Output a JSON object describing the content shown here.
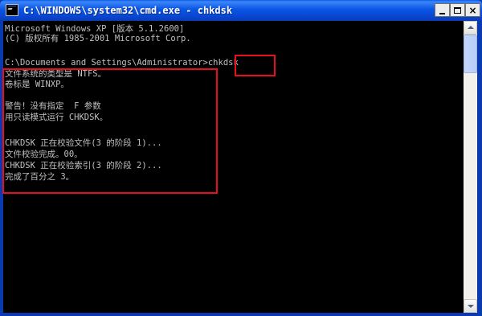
{
  "window": {
    "title": "C:\\WINDOWS\\system32\\cmd.exe - chkdsk",
    "icon": "console-icon"
  },
  "title_buttons": {
    "minimize": "minimize-icon",
    "maximize": "maximize-icon",
    "close": "×"
  },
  "console": {
    "lines": [
      "Microsoft Windows XP [版本 5.1.2600]",
      "(C) 版权所有 1985-2001 Microsoft Corp.",
      "",
      "C:\\Documents and Settings\\Administrator>chkdsk",
      "文件系统的类型是 NTFS。",
      "卷标是 WINXP。",
      "",
      "警告！没有指定  F 参数",
      "用只读模式运行 CHKDSK。",
      "",
      "CHKDSK 正在校验文件(3 的阶段 1)...",
      "文件校验完成。00。",
      "CHKDSK 正在校验索引(3 的阶段 2)...",
      "完成了百分之 3。"
    ]
  },
  "highlights": {
    "color": "#e8101c"
  }
}
